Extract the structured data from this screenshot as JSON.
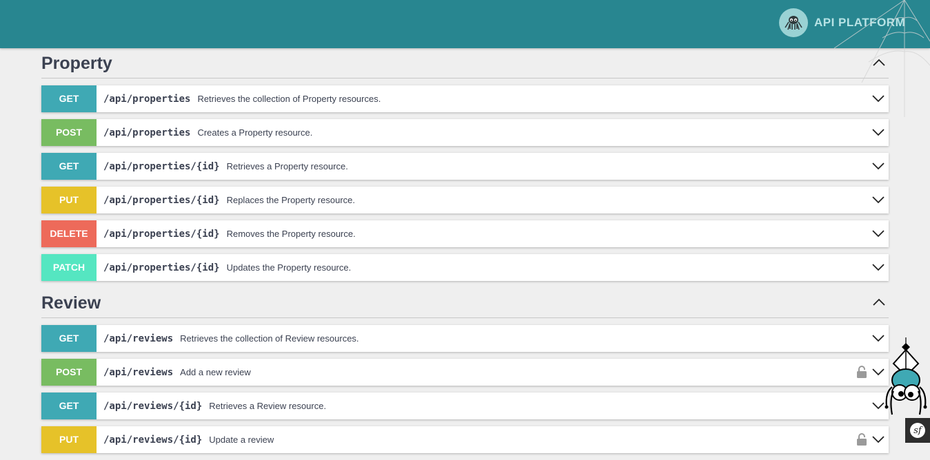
{
  "header": {
    "brand_text": "API PLATFORM",
    "background": "#288690"
  },
  "method_colors": {
    "GET": "#3fa9b4",
    "POST": "#78bc61",
    "PUT": "#e6c229",
    "DELETE": "#ed6a5a",
    "PATCH": "#55e6c1"
  },
  "sections": [
    {
      "title": "Property",
      "operations": [
        {
          "method": "GET",
          "path": "/api/properties",
          "summary": "Retrieves the collection of Property resources.",
          "locked": false
        },
        {
          "method": "POST",
          "path": "/api/properties",
          "summary": "Creates a Property resource.",
          "locked": false
        },
        {
          "method": "GET",
          "path": "/api/properties/{id}",
          "summary": "Retrieves a Property resource.",
          "locked": false
        },
        {
          "method": "PUT",
          "path": "/api/properties/{id}",
          "summary": "Replaces the Property resource.",
          "locked": false
        },
        {
          "method": "DELETE",
          "path": "/api/properties/{id}",
          "summary": "Removes the Property resource.",
          "locked": false
        },
        {
          "method": "PATCH",
          "path": "/api/properties/{id}",
          "summary": "Updates the Property resource.",
          "locked": false
        }
      ]
    },
    {
      "title": "Review",
      "operations": [
        {
          "method": "GET",
          "path": "/api/reviews",
          "summary": "Retrieves the collection of Review resources.",
          "locked": false
        },
        {
          "method": "POST",
          "path": "/api/reviews",
          "summary": "Add a new review",
          "locked": true
        },
        {
          "method": "GET",
          "path": "/api/reviews/{id}",
          "summary": "Retrieves a Review resource.",
          "locked": false
        },
        {
          "method": "PUT",
          "path": "/api/reviews/{id}",
          "summary": "Update a review",
          "locked": true
        }
      ]
    }
  ],
  "footer_badge": "sf"
}
